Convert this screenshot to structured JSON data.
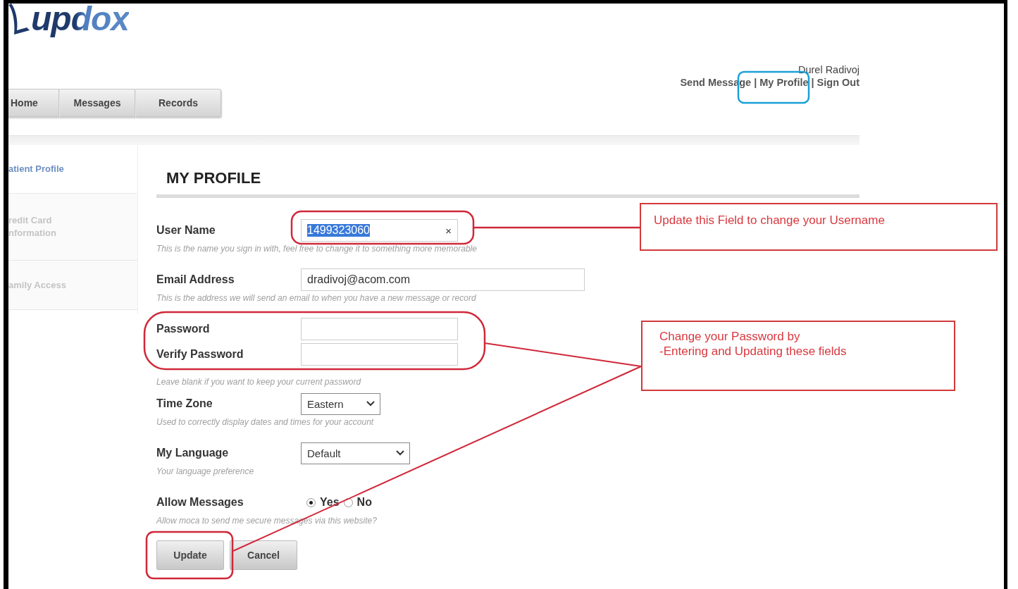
{
  "logo": {
    "text": "updox"
  },
  "user": {
    "name": "Durel Radivoj",
    "links": [
      {
        "label": "Send Message"
      },
      {
        "label": "My Profile"
      },
      {
        "label": "Sign Out"
      }
    ],
    "separator": "|"
  },
  "nav_tabs": [
    {
      "label": "Home",
      "selected": false
    },
    {
      "label": "Messages",
      "selected": false
    },
    {
      "label": "Records",
      "selected": false
    }
  ],
  "sidebar": {
    "items": [
      {
        "label": "atient Profile",
        "selected": true
      },
      {
        "label": "redit Card nformation",
        "selected": false
      },
      {
        "label": "amily Access",
        "selected": false
      }
    ]
  },
  "page_title": "MY PROFILE",
  "form": {
    "fields": [
      {
        "kind": "text",
        "label": "User Name",
        "value": "1499323060",
        "value_selected": true,
        "clear": "×",
        "hint": "This is the name you sign in with, feel free to change it to something more memorable"
      },
      {
        "kind": "text",
        "label": "Email Address",
        "value": "dradivoj@acom.com",
        "value_selected": false,
        "wide": true,
        "hint": "This is the address we will send an email to when you have a new message or record"
      },
      {
        "kind": "password",
        "label": "Password"
      },
      {
        "kind": "password",
        "label": "Verify Password",
        "hint": "Leave blank if you want to keep your current password"
      },
      {
        "kind": "select",
        "label": "Time Zone",
        "value": "Eastern",
        "hint": "Used to correctly display dates and times for your account"
      },
      {
        "kind": "select",
        "label": "My Language",
        "value": "Default",
        "wide": true,
        "hint": "Your language preference"
      },
      {
        "kind": "radio",
        "label": "Allow Messages",
        "options": [
          {
            "label": "Yes",
            "selected": true
          },
          {
            "label": "No",
            "selected": false
          }
        ],
        "hint": "Allow moca to send me secure messages via this website?"
      }
    ]
  },
  "buttons": [
    {
      "label": "Update"
    },
    {
      "label": "Cancel"
    }
  ],
  "annotations": [
    {
      "text": "Update this Field to change your Username"
    },
    {
      "text": "Change your Password by\n-Entering and Updating these fields"
    }
  ]
}
